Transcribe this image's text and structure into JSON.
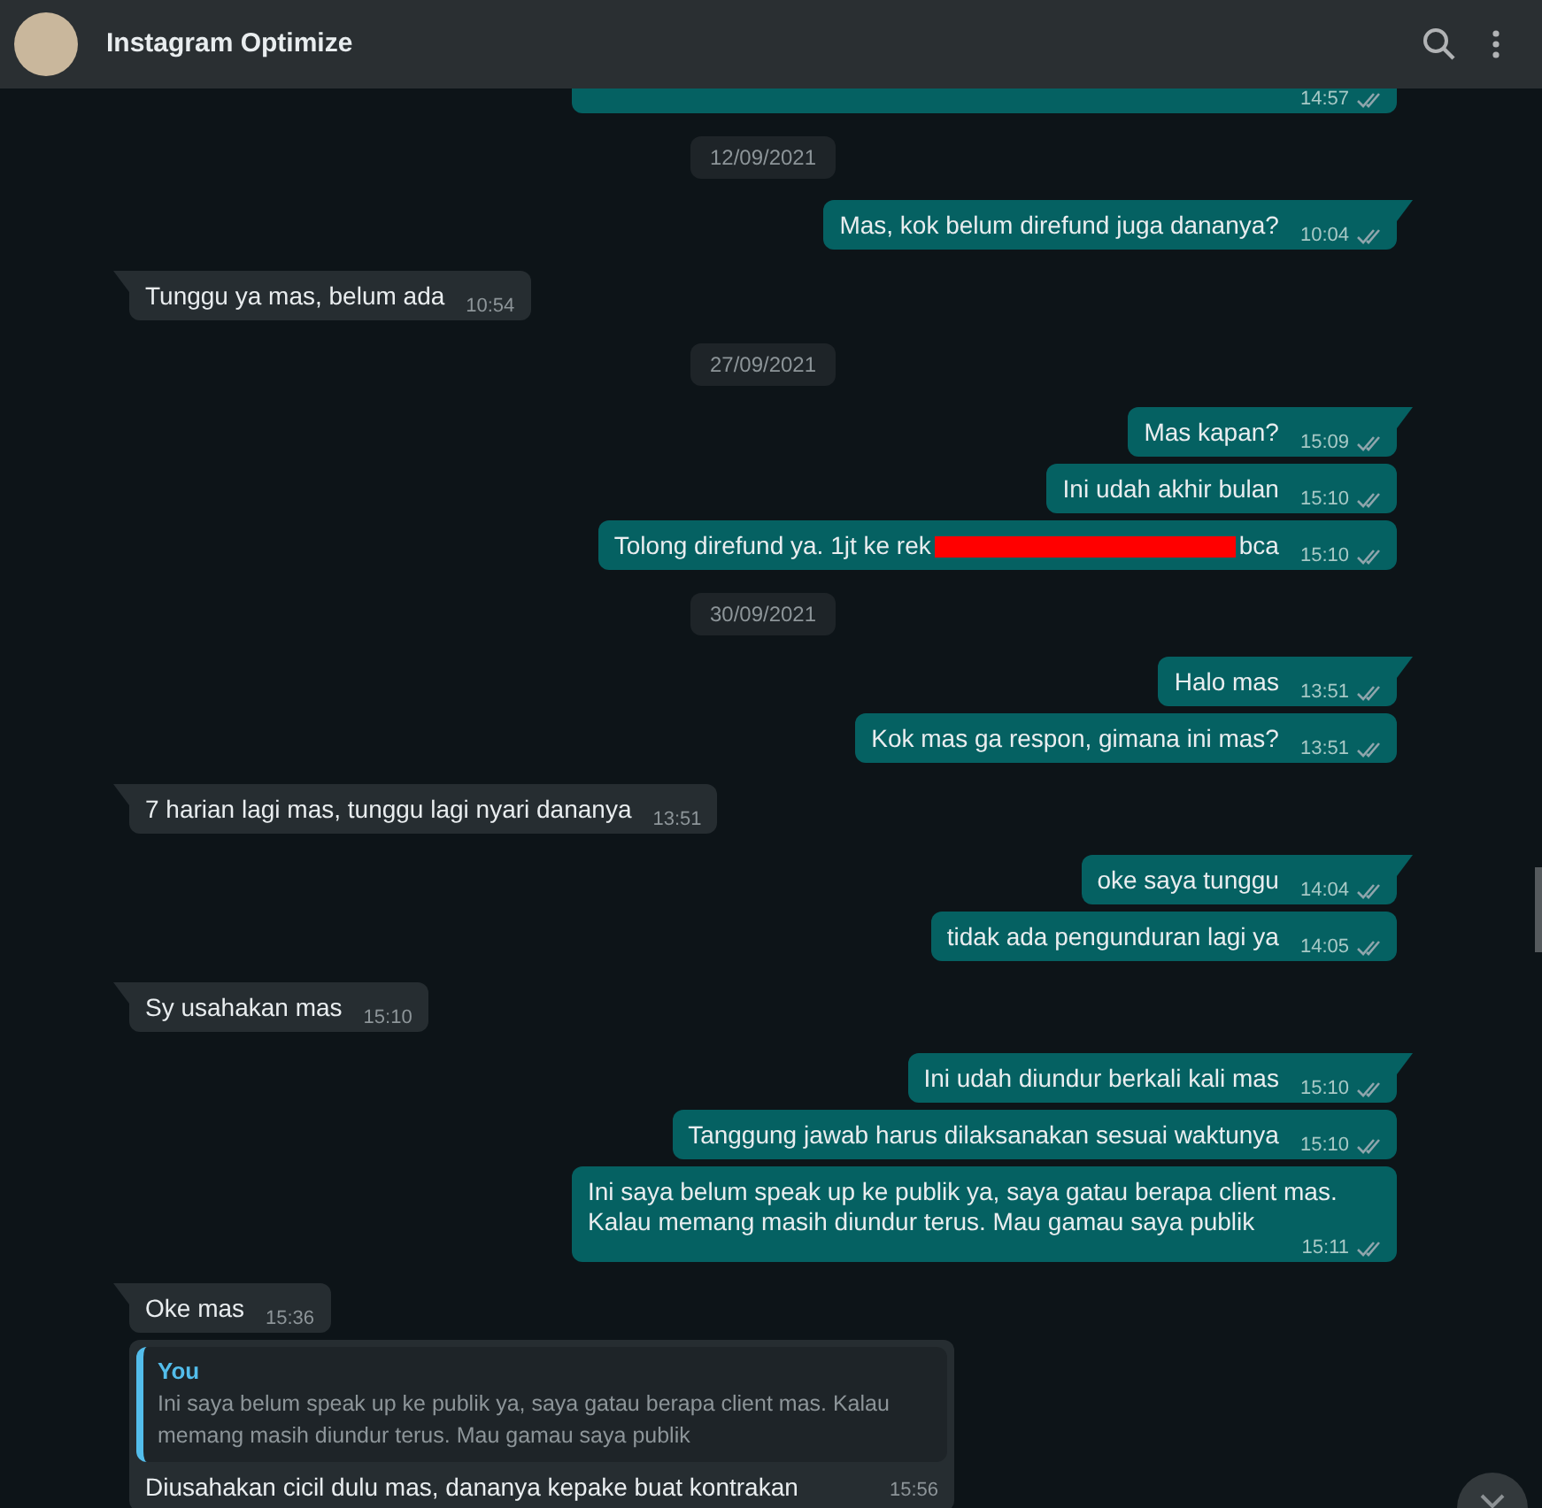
{
  "header": {
    "title": "Instagram Optimize"
  },
  "messages": [
    {
      "kind": "outgoing",
      "time": "14:57",
      "read": false,
      "cut": true
    },
    {
      "kind": "date",
      "text": "12/09/2021"
    },
    {
      "kind": "outgoing",
      "text": "Mas, kok belum direfund juga dananya?",
      "time": "10:04",
      "read": false,
      "tail": true
    },
    {
      "kind": "incoming",
      "text": "Tunggu ya mas, belum ada",
      "time": "10:54",
      "tail": true
    },
    {
      "kind": "date",
      "text": "27/09/2021"
    },
    {
      "kind": "outgoing",
      "text": "Mas kapan?",
      "time": "15:09",
      "read": false,
      "tail": true
    },
    {
      "kind": "outgoing",
      "text": "Ini udah akhir bulan",
      "time": "15:10",
      "read": false,
      "tail": false
    },
    {
      "kind": "outgoing",
      "text": "Tolong direfund ya. 1jt ke rek",
      "redacted": true,
      "text_after": "bca",
      "time": "15:10",
      "read": false,
      "tail": false
    },
    {
      "kind": "date",
      "text": "30/09/2021"
    },
    {
      "kind": "outgoing",
      "text": "Halo mas",
      "time": "13:51",
      "read": false,
      "tail": true
    },
    {
      "kind": "outgoing",
      "text": "Kok mas ga respon, gimana ini mas?",
      "time": "13:51",
      "read": false,
      "tail": false
    },
    {
      "kind": "incoming",
      "text": "7 harian lagi mas, tunggu lagi nyari dananya",
      "time": "13:51",
      "tail": true
    },
    {
      "kind": "outgoing",
      "text": "oke saya tunggu",
      "time": "14:04",
      "read": false,
      "tail": true
    },
    {
      "kind": "outgoing",
      "text": "tidak ada pengunduran lagi ya",
      "time": "14:05",
      "read": false,
      "tail": false
    },
    {
      "kind": "incoming",
      "text": "Sy usahakan mas",
      "time": "15:10",
      "tail": true
    },
    {
      "kind": "outgoing",
      "text": "Ini udah diundur berkali kali mas",
      "time": "15:10",
      "read": false,
      "tail": true
    },
    {
      "kind": "outgoing",
      "text": "Tanggung jawab harus dilaksanakan sesuai waktunya",
      "time": "15:10",
      "read": false,
      "tail": false
    },
    {
      "kind": "outgoing",
      "text": "Ini saya belum speak up ke publik ya, saya gatau berapa client mas. Kalau memang masih diundur terus. Mau gamau saya publik",
      "time": "15:11",
      "read": false,
      "tail": false
    },
    {
      "kind": "incoming",
      "text": "Oke mas",
      "time": "15:36",
      "tail": true
    },
    {
      "kind": "reply",
      "quote": {
        "author": "You",
        "text": "Ini saya belum speak up ke publik ya, saya gatau berapa client mas. Kalau memang masih diundur terus. Mau gamau saya publik"
      },
      "text": "Diusahakan cicil dulu mas, dananya kepake buat kontrakan",
      "time": "15:56"
    }
  ]
}
